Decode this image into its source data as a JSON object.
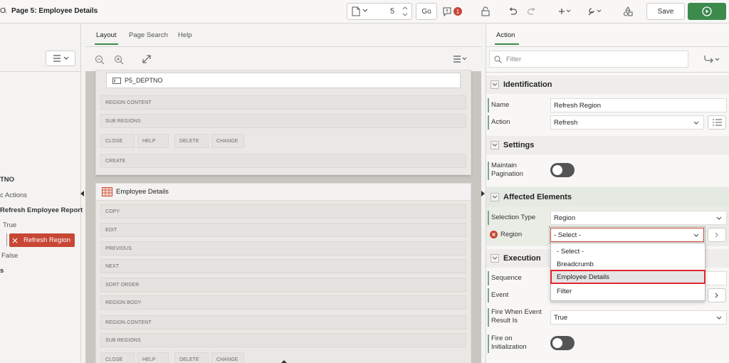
{
  "header": {
    "breadcrumb_fragment": "O",
    "page_title": "Page 5: Employee Details",
    "page_number": "5",
    "go_label": "Go",
    "warning_count": "1",
    "save_label": "Save",
    "colors": {
      "accent_green": "#3d8a4d",
      "badge_red": "#c74634"
    }
  },
  "left_tree": {
    "items": [
      {
        "label": "TNO"
      },
      {
        "label": "c Actions"
      },
      {
        "label": "Refresh Employee Report"
      },
      {
        "label": "True"
      },
      {
        "label": "Refresh Region"
      },
      {
        "label": "False"
      },
      {
        "label": "s"
      }
    ]
  },
  "middle": {
    "tabs": [
      {
        "label": "Layout"
      },
      {
        "label": "Page Search"
      },
      {
        "label": "Help"
      }
    ],
    "item_field": "P5_DEPTNO",
    "top_region_positions": [
      "REGION CONTENT",
      "SUB REGIONS",
      "CLOSE",
      "HELP",
      "DELETE",
      "CHANGE",
      "CREATE"
    ],
    "employee_region": {
      "title": "Employee Details",
      "positions": [
        "COPY",
        "EDIT",
        "PREVIOUS",
        "NEXT",
        "SORT ORDER",
        "REGION BODY",
        "REGION CONTENT",
        "SUB REGIONS",
        "CLOSE",
        "HELP",
        "DELETE",
        "CHANGE"
      ]
    }
  },
  "right": {
    "tab": "Action",
    "filter_placeholder": "Filter",
    "sections": {
      "identification": "Identification",
      "settings": "Settings",
      "affected": "Affected Elements",
      "execution": "Execution"
    },
    "props": {
      "name_label": "Name",
      "name_value": "Refresh Region",
      "action_label": "Action",
      "action_value": "Refresh",
      "pagination_label": "Maintain Pagination",
      "selection_type_label": "Selection Type",
      "selection_type_value": "Region",
      "region_label": "Region",
      "region_value": "- Select -",
      "sequence_label": "Sequence",
      "event_label": "Event",
      "fire_when_label": "Fire When Event Result Is",
      "fire_when_value": "True",
      "fire_init_label": "Fire on Initialization"
    },
    "dropdown_options": [
      "- Select -",
      "Breadcrumb",
      "Employee Details",
      "Filter"
    ],
    "highlighted_option": "Employee Details"
  }
}
